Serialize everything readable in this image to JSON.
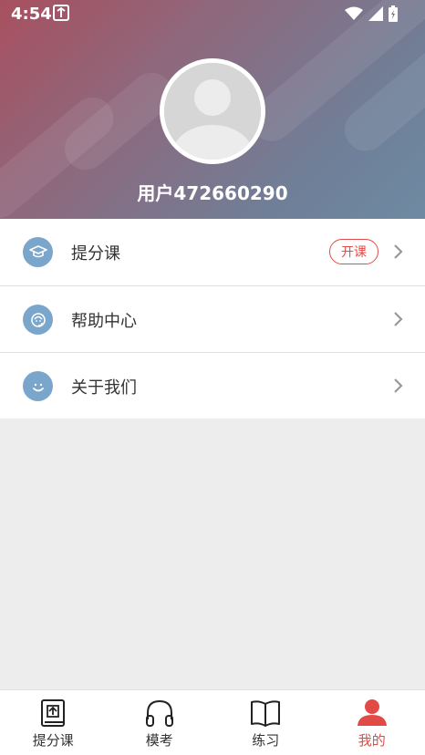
{
  "status_bar": {
    "time": "4:54"
  },
  "profile": {
    "username": "用户472660290"
  },
  "menu": {
    "items": [
      {
        "label": "提分课",
        "badge": "开课"
      },
      {
        "label": "帮助中心"
      },
      {
        "label": "关于我们"
      }
    ]
  },
  "tabbar": {
    "tabs": [
      {
        "label": "提分课"
      },
      {
        "label": "模考"
      },
      {
        "label": "练习"
      },
      {
        "label": "我的",
        "active": true
      }
    ]
  },
  "colors": {
    "accent": "#e24b45",
    "menu_icon_bg": "#7aa6cc",
    "header_start": "#a8505f",
    "header_end": "#6e8aa2"
  },
  "icons": [
    "graduation-cap-icon",
    "help-headset-icon",
    "smile-icon",
    "chevron-right-icon",
    "book-upload-icon",
    "headphones-icon",
    "open-book-icon",
    "person-icon"
  ]
}
